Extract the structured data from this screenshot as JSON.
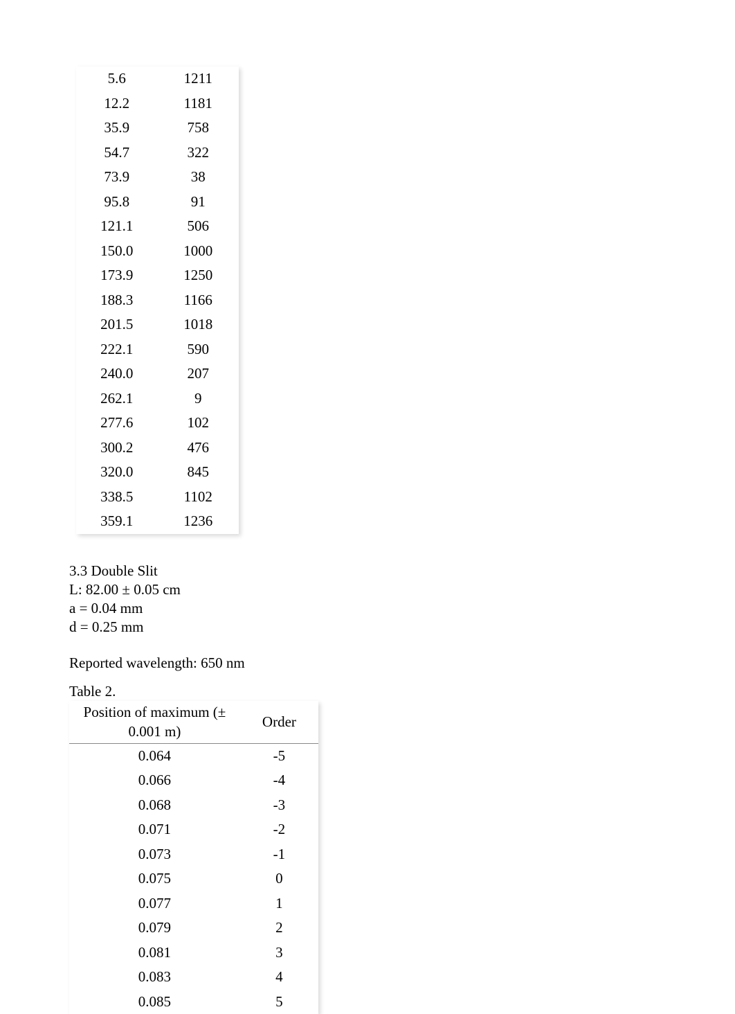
{
  "chart_data": [
    {
      "type": "table",
      "columns": [
        "col_a",
        "col_b"
      ],
      "rows": [
        [
          5.6,
          1211
        ],
        [
          12.2,
          1181
        ],
        [
          35.9,
          758
        ],
        [
          54.7,
          322
        ],
        [
          73.9,
          38
        ],
        [
          95.8,
          91
        ],
        [
          121.1,
          506
        ],
        [
          150.0,
          1000
        ],
        [
          173.9,
          1250
        ],
        [
          188.3,
          1166
        ],
        [
          201.5,
          1018
        ],
        [
          222.1,
          590
        ],
        [
          240.0,
          207
        ],
        [
          262.1,
          9
        ],
        [
          277.6,
          102
        ],
        [
          300.2,
          476
        ],
        [
          320.0,
          845
        ],
        [
          338.5,
          1102
        ],
        [
          359.1,
          1236
        ]
      ]
    },
    {
      "type": "table",
      "title": "Table 2.",
      "columns": [
        "Position of maximum (± 0.001 m)",
        "Order"
      ],
      "rows": [
        [
          0.064,
          -5
        ],
        [
          0.066,
          -4
        ],
        [
          0.068,
          -3
        ],
        [
          0.071,
          -2
        ],
        [
          0.073,
          -1
        ],
        [
          0.075,
          0
        ],
        [
          0.077,
          1
        ],
        [
          0.079,
          2
        ],
        [
          0.081,
          3
        ],
        [
          0.083,
          4
        ],
        [
          0.085,
          5
        ]
      ]
    }
  ],
  "table1": {
    "rows": [
      [
        "5.6",
        "1211"
      ],
      [
        "12.2",
        "1181"
      ],
      [
        "35.9",
        "758"
      ],
      [
        "54.7",
        "322"
      ],
      [
        "73.9",
        "38"
      ],
      [
        "95.8",
        "91"
      ],
      [
        "121.1",
        "506"
      ],
      [
        "150.0",
        "1000"
      ],
      [
        "173.9",
        "1250"
      ],
      [
        "188.3",
        "1166"
      ],
      [
        "201.5",
        "1018"
      ],
      [
        "222.1",
        "590"
      ],
      [
        "240.0",
        "207"
      ],
      [
        "262.1",
        "9"
      ],
      [
        "277.6",
        "102"
      ],
      [
        "300.2",
        "476"
      ],
      [
        "320.0",
        "845"
      ],
      [
        "338.5",
        "1102"
      ],
      [
        "359.1",
        "1236"
      ]
    ]
  },
  "section": {
    "heading": "3.3 Double Slit",
    "L": "L: 82.00 ± 0.05 cm",
    "a": "a = 0.04 mm",
    "d": "d = 0.25 mm",
    "reported": "Reported wavelength: 650 nm"
  },
  "table2": {
    "caption": "Table 2.",
    "headers": {
      "pos": "Position of maximum (± 0.001 m)",
      "order": "Order"
    },
    "rows": [
      [
        "0.064",
        "-5"
      ],
      [
        "0.066",
        "-4"
      ],
      [
        "0.068",
        "-3"
      ],
      [
        "0.071",
        "-2"
      ],
      [
        "0.073",
        "-1"
      ],
      [
        "0.075",
        "0"
      ],
      [
        "0.077",
        "1"
      ],
      [
        "0.079",
        "2"
      ],
      [
        "0.081",
        "3"
      ],
      [
        "0.083",
        "4"
      ],
      [
        "0.085",
        "5"
      ]
    ]
  }
}
